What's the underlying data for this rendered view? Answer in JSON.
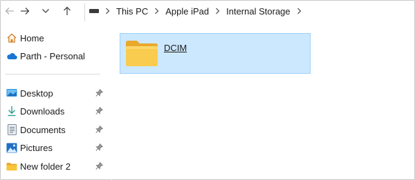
{
  "breadcrumb": {
    "drive_icon": "drive-icon",
    "items": [
      "This PC",
      "Apple iPad",
      "Internal Storage"
    ]
  },
  "nav": {
    "icons": [
      "back-arrow-icon",
      "forward-arrow-icon",
      "recent-locations-chevron-icon",
      "up-arrow-icon"
    ]
  },
  "sidebar": {
    "top_items": [
      {
        "label": "Home",
        "icon": "home-icon"
      },
      {
        "label": "Parth - Personal",
        "icon": "onedrive-cloud-icon"
      }
    ],
    "pinned_items": [
      {
        "label": "Desktop",
        "icon": "desktop-icon",
        "pinned": true
      },
      {
        "label": "Downloads",
        "icon": "download-arrow-icon",
        "pinned": true
      },
      {
        "label": "Documents",
        "icon": "documents-icon",
        "pinned": true
      },
      {
        "label": "Pictures",
        "icon": "pictures-icon",
        "pinned": true
      },
      {
        "label": "New folder 2",
        "icon": "folder-icon",
        "pinned": true
      }
    ]
  },
  "content": {
    "items": [
      {
        "name": "DCIM",
        "type": "folder",
        "selected": true
      }
    ]
  },
  "colors": {
    "selection_fill": "#cce8ff",
    "selection_border": "#99d1ff",
    "folder_yellow": "#f8c43a"
  }
}
